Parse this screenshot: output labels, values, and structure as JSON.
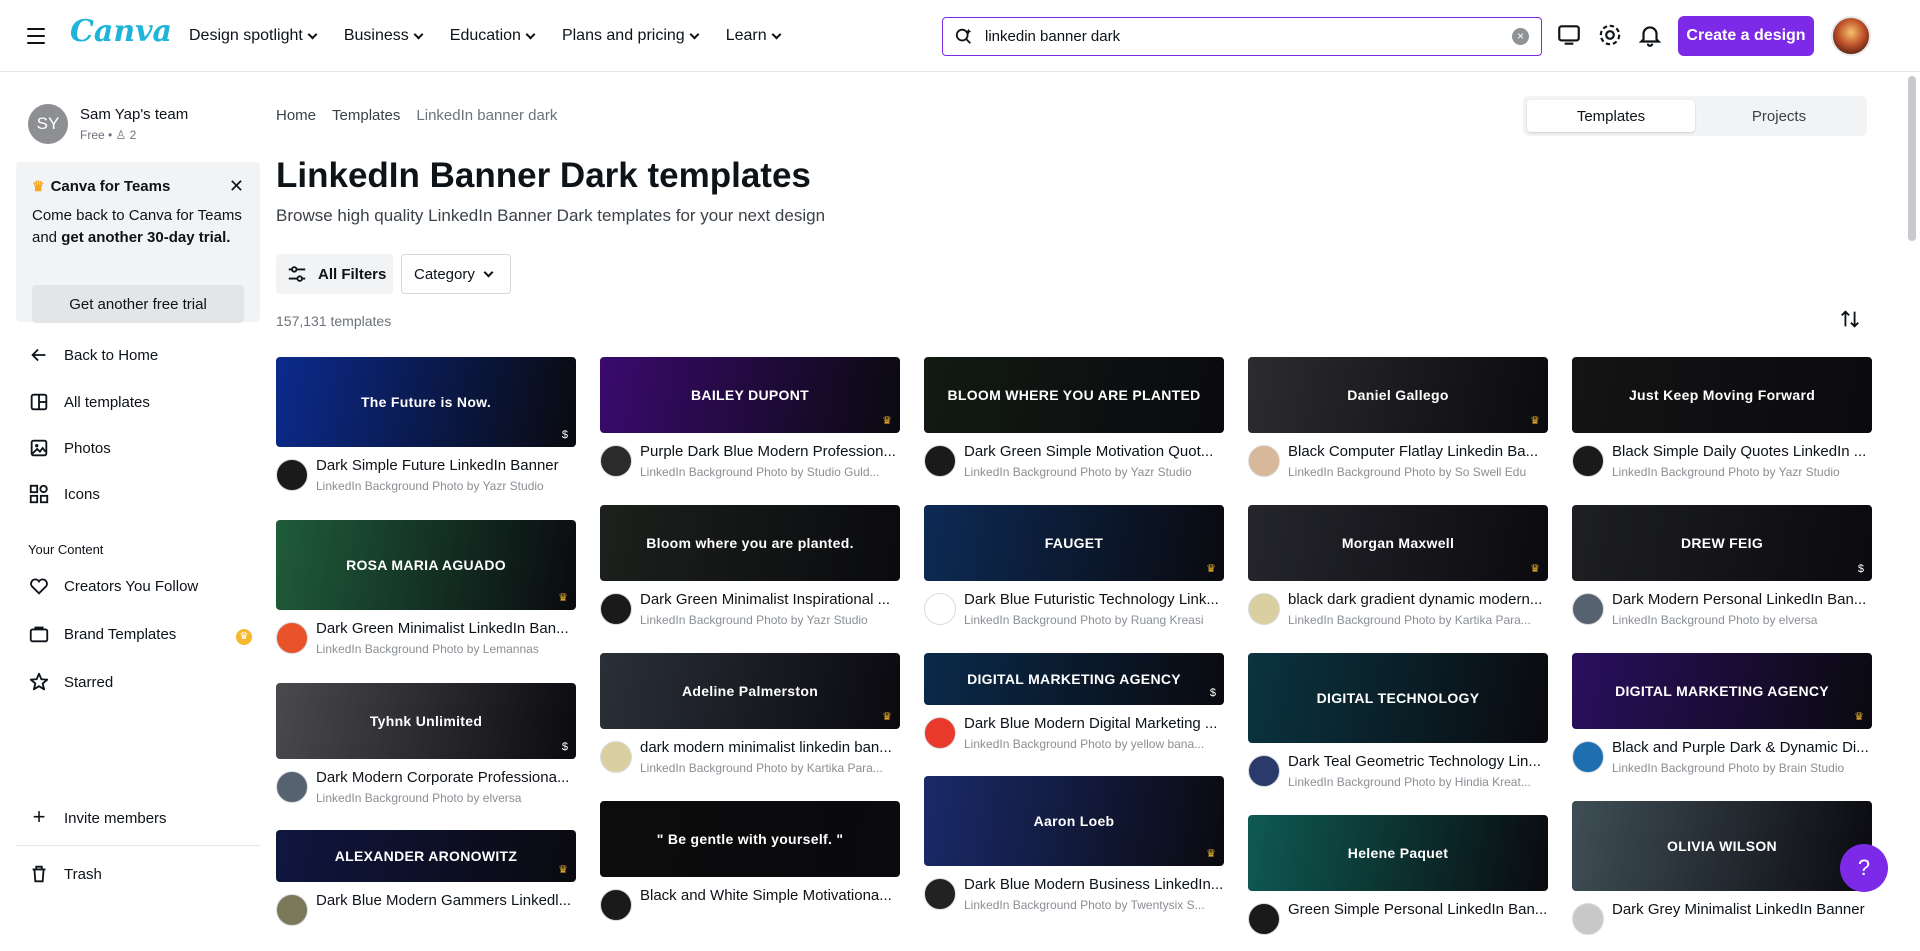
{
  "header": {
    "logo": "Canva",
    "nav": [
      {
        "label": "Design spotlight"
      },
      {
        "label": "Business"
      },
      {
        "label": "Education"
      },
      {
        "label": "Plans and pricing"
      },
      {
        "label": "Learn"
      }
    ],
    "search_value": "linkedin banner dark",
    "create_label": "Create a design"
  },
  "sidebar": {
    "team_initials": "SY",
    "team_name": "Sam Yap's team",
    "team_sub": "Free • ♙ 2",
    "promo": {
      "title": "Canva for Teams",
      "body_start": "Come back to Canva for Teams and ",
      "body_bold": "get another 30-day trial.",
      "button": "Get another free trial"
    },
    "nav": [
      {
        "label": "Back to Home"
      },
      {
        "label": "All templates"
      },
      {
        "label": "Photos"
      },
      {
        "label": "Icons"
      }
    ],
    "section_label": "Your Content",
    "content": [
      {
        "label": "Creators You Follow"
      },
      {
        "label": "Brand Templates"
      },
      {
        "label": "Starred"
      }
    ],
    "invite": "Invite members",
    "trash": "Trash"
  },
  "main": {
    "breadcrumb": [
      "Home",
      "Templates",
      "LinkedIn banner dark"
    ],
    "toggle": [
      "Templates",
      "Projects"
    ],
    "title": "LinkedIn Banner Dark templates",
    "subtitle": "Browse high quality LinkedIn Banner Dark templates for your next design",
    "filters_label": "All Filters",
    "category_label": "Category",
    "count": "157,131 templates"
  },
  "templates": [
    {
      "title": "Dark Simple Future LinkedIn Banner",
      "sub": "LinkedIn Background Photo by Yazr Studio",
      "thumb_text": "The Future is Now.",
      "bg": "#0b2a8c",
      "av": "#1a1a1a"
    },
    {
      "title": "Dark Green Minimalist LinkedIn Ban...",
      "sub": "LinkedIn Background Photo by Lemannas",
      "thumb_text": "ROSA MARIA AGUADO",
      "bg": "#1f5c3a",
      "av": "#e9532a"
    },
    {
      "title": "Dark Modern Corporate Professiona...",
      "sub": "LinkedIn Background Photo by elversa",
      "thumb_text": "Tyhnk Unlimited",
      "bg": "#4a4a4e",
      "av": "#566270"
    },
    {
      "title": "Dark Blue Modern Gammers Linkedl...",
      "sub": "",
      "thumb_text": "ALEXANDER ARONOWITZ",
      "bg": "#101640",
      "av": "#7a7a5a"
    },
    {
      "title": "Purple Dark Blue Modern Profession...",
      "sub": "LinkedIn Background Photo by Studio Guld...",
      "thumb_text": "BAILEY DUPONT",
      "bg": "#3a0a6e",
      "av": "#2b2b2b"
    },
    {
      "title": "Dark Green Minimalist Inspirational ...",
      "sub": "LinkedIn Background Photo by Yazr Studio",
      "thumb_text": "Bloom where you are planted.",
      "bg": "#1c211c",
      "av": "#1a1a1a"
    },
    {
      "title": "dark modern minimalist linkedin ban...",
      "sub": "LinkedIn Background Photo by Kartika Para...",
      "thumb_text": "Adeline Palmerston",
      "bg": "#2a2f38",
      "av": "#d9cfa0"
    },
    {
      "title": "Black and White Simple Motivationa...",
      "sub": "",
      "thumb_text": "\" Be gentle with yourself. \"",
      "bg": "#0c0c0c",
      "av": "#1a1a1a"
    },
    {
      "title": "Dark Green Simple Motivation Quot...",
      "sub": "LinkedIn Background Photo by Yazr Studio",
      "thumb_text": "BLOOM WHERE YOU ARE PLANTED",
      "bg": "#121a12",
      "av": "#1a1a1a"
    },
    {
      "title": "Dark Blue Futuristic Technology Link...",
      "sub": "LinkedIn Background Photo by Ruang Kreasi",
      "thumb_text": "FAUGET",
      "bg": "#0d2a55",
      "av": "#ffffff"
    },
    {
      "title": "Dark Blue Modern Digital Marketing ...",
      "sub": "LinkedIn Background Photo by yellow bana...",
      "thumb_text": "DIGITAL MARKETING AGENCY",
      "bg": "#0a2a4a",
      "av": "#e8392a"
    },
    {
      "title": "Dark Blue Modern Business LinkedIn...",
      "sub": "LinkedIn Background Photo by Twentysix S...",
      "thumb_text": "Aaron Loeb",
      "bg": "#1a2a6a",
      "av": "#222222"
    },
    {
      "title": "Black Computer Flatlay Linkedin Ba...",
      "sub": "LinkedIn Background Photo by So Swell Edu",
      "thumb_text": "Daniel Gallego",
      "bg": "#2c2c2e",
      "av": "#d8b89a"
    },
    {
      "title": "black dark gradient dynamic modern...",
      "sub": "LinkedIn Background Photo by Kartika Para...",
      "thumb_text": "Morgan Maxwell",
      "bg": "#25262b",
      "av": "#d9cfa0"
    },
    {
      "title": "Dark Teal Geometric Technology Lin...",
      "sub": "LinkedIn Background Photo by Hindia Kreat...",
      "thumb_text": "DIGITAL TECHNOLOGY",
      "bg": "#0a3440",
      "av": "#2a3a6a"
    },
    {
      "title": "Green Simple Personal LinkedIn Ban...",
      "sub": "",
      "thumb_text": "Helene Paquet",
      "bg": "#0e5a52",
      "av": "#1a1a1a"
    },
    {
      "title": "Black Simple Daily Quotes LinkedIn ...",
      "sub": "LinkedIn Background Photo by Yazr Studio",
      "thumb_text": "Just Keep Moving Forward",
      "bg": "#141414",
      "av": "#1a1a1a"
    },
    {
      "title": "Dark Modern Personal LinkedIn Ban...",
      "sub": "LinkedIn Background Photo by elversa",
      "thumb_text": "DREW FEIG",
      "bg": "#1e1f22",
      "av": "#566270"
    },
    {
      "title": "Black and Purple Dark & Dynamic Di...",
      "sub": "LinkedIn Background Photo by Brain Studio",
      "thumb_text": "DIGITAL MARKETING AGENCY",
      "bg": "#2a0f5e",
      "av": "#1e6fb0"
    },
    {
      "title": "Dark Grey Minimalist LinkedIn Banner",
      "sub": "",
      "thumb_text": "OLIVIA WILSON",
      "bg": "#3f4e56",
      "av": "#c8c8c8"
    }
  ],
  "colors": {
    "accent": "#7d2ae8",
    "logo": "#1fb4d8"
  }
}
